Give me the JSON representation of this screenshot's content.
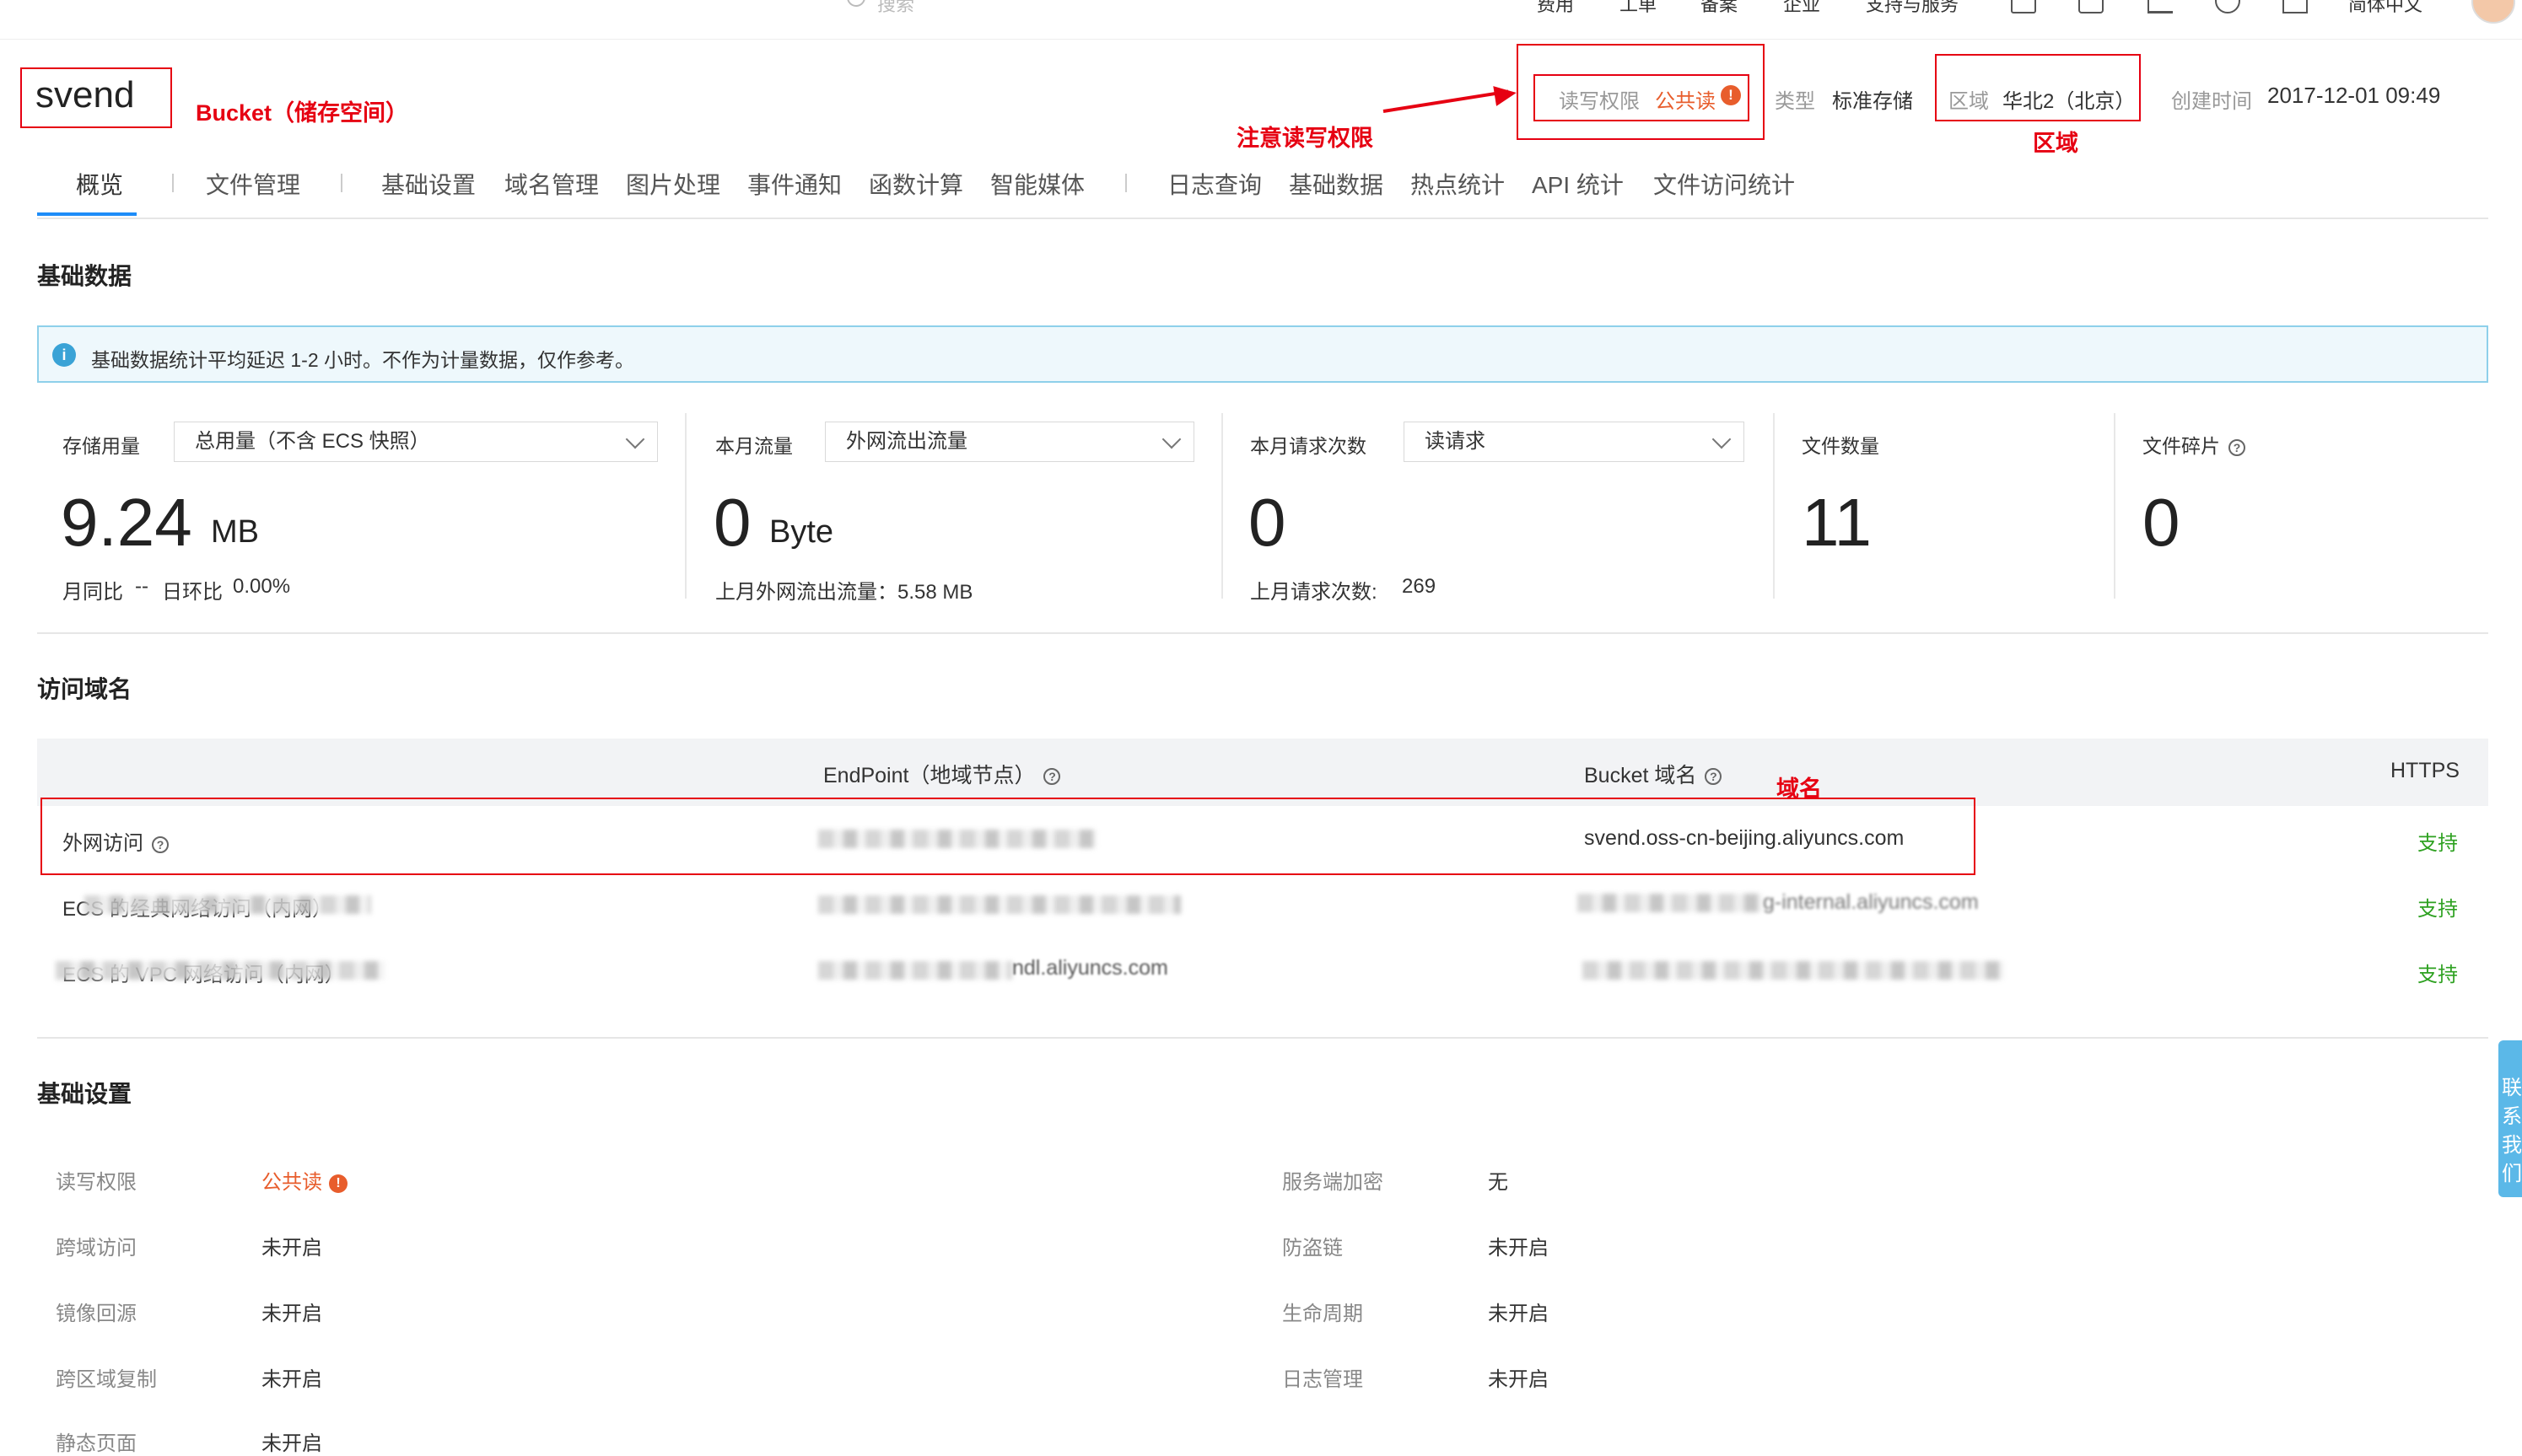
{
  "topnav": {
    "search_placeholder": "搜索",
    "items": [
      "费用",
      "工单",
      "备案",
      "企业",
      "支持与服务"
    ],
    "language": "简体中文"
  },
  "bucket": {
    "name": "svend",
    "annotation": "Bucket（储存空间）"
  },
  "header": {
    "acl_label": "读写权限",
    "acl_value": "公共读",
    "type_label": "类型",
    "type_value": "标准存储",
    "region_label": "区域",
    "region_value": "华北2（北京）",
    "created_label": "创建时间",
    "created_value": "2017-12-01 09:49"
  },
  "annotations": {
    "acl_note": "注意读写权限",
    "region_note": "区域",
    "domain_note": "域名"
  },
  "tabs": [
    "概览",
    "文件管理",
    "基础设置",
    "域名管理",
    "图片处理",
    "事件通知",
    "函数计算",
    "智能媒体",
    "日志查询",
    "基础数据",
    "热点统计",
    "API 统计",
    "文件访问统计"
  ],
  "basic_data": {
    "title": "基础数据",
    "notice": "基础数据统计平均延迟 1-2 小时。不作为计量数据，仅作参考。",
    "storage": {
      "label": "存储用量",
      "select": "总用量（不含 ECS 快照）",
      "value": "9.24",
      "unit": "MB",
      "sub_a": "月同比",
      "sub_a_val": "--",
      "sub_b": "日环比",
      "sub_b_val": "0.00%"
    },
    "traffic": {
      "label": "本月流量",
      "select": "外网流出流量",
      "value": "0",
      "unit": "Byte",
      "sub": "上月外网流出流量：5.58 MB"
    },
    "requests": {
      "label": "本月请求次数",
      "select": "读请求",
      "value": "0",
      "sub": "上月请求次数:",
      "sub_val": "269"
    },
    "files": {
      "label": "文件数量",
      "value": "11"
    },
    "fragments": {
      "label": "文件碎片",
      "value": "0"
    }
  },
  "domains": {
    "title": "访问域名",
    "headers": {
      "endpoint": "EndPoint（地域节点）",
      "bucket_domain": "Bucket 域名",
      "https": "HTTPS"
    },
    "rows": [
      {
        "name": "外网访问",
        "bucket_domain": "svend.oss-cn-beijing.aliyuncs.com",
        "https": "支持"
      },
      {
        "name": "ECS 的经典网络访问（内网）",
        "bucket_domain": "",
        "https": "支持"
      },
      {
        "name": "ECS 的 VPC 网络访问（内网）",
        "bucket_domain": "",
        "https": "支持"
      }
    ],
    "row2_endpoint_tail": "ndl.aliyuncs.com",
    "row1_domain_tail": "g-internal.aliyuncs.com"
  },
  "settings": {
    "title": "基础设置",
    "left": [
      {
        "label": "读写权限",
        "value": "公共读"
      },
      {
        "label": "跨域访问",
        "value": "未开启"
      },
      {
        "label": "镜像回源",
        "value": "未开启"
      },
      {
        "label": "跨区域复制",
        "value": "未开启"
      },
      {
        "label": "静态页面",
        "value": "未开启"
      }
    ],
    "right": [
      {
        "label": "服务端加密",
        "value": "无"
      },
      {
        "label": "防盗链",
        "value": "未开启"
      },
      {
        "label": "生命周期",
        "value": "未开启"
      },
      {
        "label": "日志管理",
        "value": "未开启"
      }
    ]
  },
  "contact_tab": "联系我们"
}
